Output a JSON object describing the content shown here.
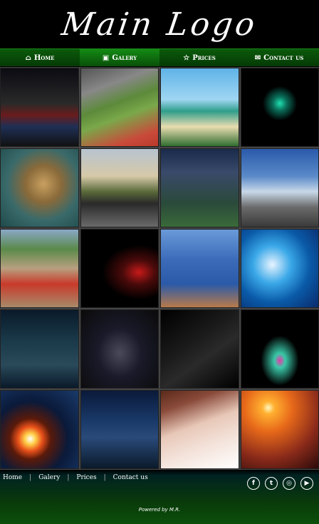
{
  "header": {
    "logo_text": "Main Logo"
  },
  "nav": {
    "items": [
      {
        "label": "Home",
        "icon": "home-icon",
        "active": false
      },
      {
        "label": "Galery",
        "icon": "image-icon",
        "active": true
      },
      {
        "label": "Prices",
        "icon": "star-icon",
        "active": false
      },
      {
        "label": "Contact us",
        "icon": "envelope-icon",
        "active": false
      }
    ]
  },
  "gallery": {
    "tiles": [
      "football-team-photo",
      "tennis-ball-photo",
      "tropical-beach-photo",
      "green-butterfly-photo",
      "leopard-photo",
      "muscle-car-photo",
      "soccer-stadium-photo",
      "motocross-photo",
      "rally-car-photo",
      "boxer-photo",
      "skydiver-canyon-photo",
      "surfer-wave-photo",
      "motorcycle-lake-photo",
      "formula-one-photo",
      "playing-cards-photo",
      "colorful-splash-photo",
      "space-black-hole-photo",
      "dark-knight-photo",
      "woman-portrait-photo",
      "airplane-sunset-photo"
    ]
  },
  "footer": {
    "links": [
      "Home",
      "Galery",
      "Prices",
      "Contact us"
    ],
    "social": [
      {
        "icon": "facebook-icon",
        "glyph": "f"
      },
      {
        "icon": "twitter-icon",
        "glyph": "t"
      },
      {
        "icon": "instagram-icon",
        "glyph": "◎"
      },
      {
        "icon": "youtube-icon",
        "glyph": "▶"
      }
    ],
    "powered_by": "Powered by M.R."
  }
}
